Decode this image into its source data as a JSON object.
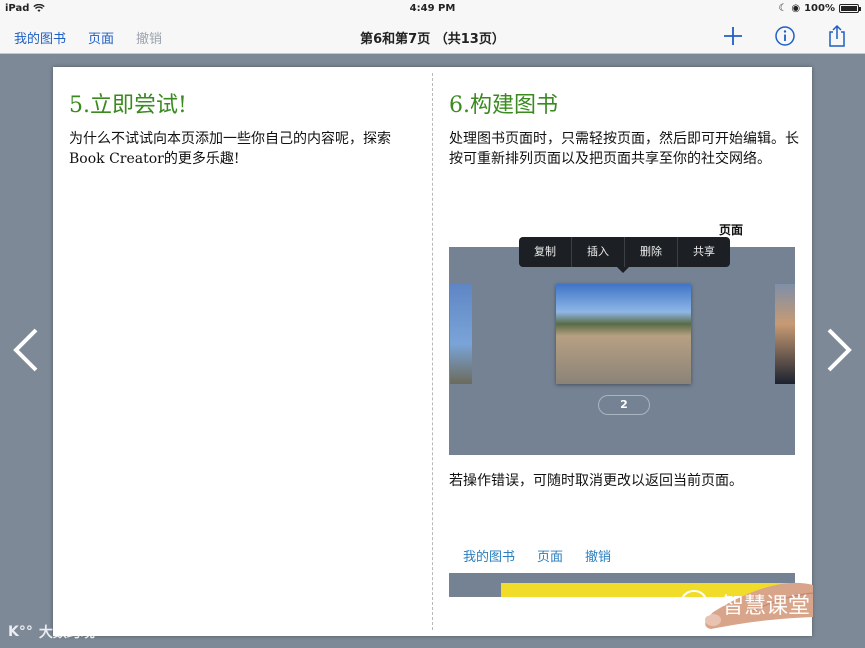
{
  "status_bar": {
    "device": "iPad",
    "time": "4:49 PM",
    "battery": "100%"
  },
  "nav": {
    "my_books": "我的图书",
    "pages": "页面",
    "undo": "撤销",
    "title": "第6和第7页 （共13页）",
    "icons": [
      "plus-icon",
      "info-icon",
      "share-icon"
    ]
  },
  "left_page": {
    "heading": "5.立即尝试!",
    "body": "为什么不试试向本页添加一些你自己的内容呢，探索Book Creator的更多乐趣!"
  },
  "right_page": {
    "heading": "6.构建图书",
    "body": "处理图书页面时，只需轻按页面，然后即可开始编辑。长按可重新排列页面以及把页面共享至你的社交网络。",
    "illustration": {
      "label": "页面",
      "menu": [
        "复制",
        "插入",
        "删除",
        "共享"
      ],
      "page_number": "2"
    },
    "undo_text": "若操作错误，可随时取消更改以返回当前页面。",
    "mini_nav": [
      "我的图书",
      "页面",
      "撤销"
    ]
  },
  "watermarks": {
    "left": "大数跨境",
    "right": "智慧课堂"
  },
  "colors": {
    "heading_green": "#3a8a1f",
    "link_blue": "#1f5fc4",
    "background": "#7d8997"
  }
}
